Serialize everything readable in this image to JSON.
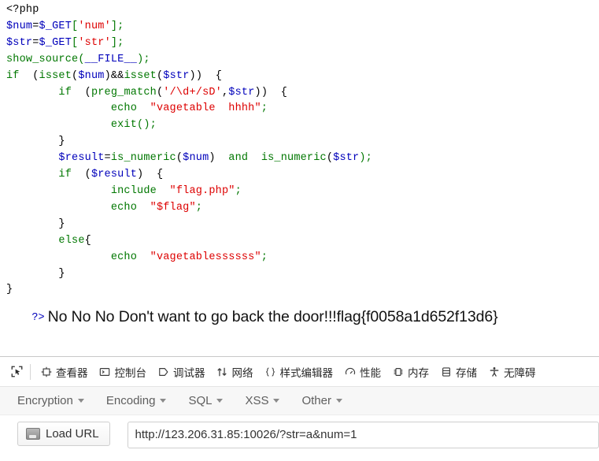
{
  "page": {
    "php_source_lines": [
      [
        {
          "t": "html",
          "s": "<?php"
        }
      ],
      [
        {
          "t": "var",
          "s": "$num"
        },
        {
          "t": "default",
          "s": "="
        },
        {
          "t": "var",
          "s": "$_GET"
        },
        {
          "t": "keyword",
          "s": "["
        },
        {
          "t": "string",
          "s": "'num'"
        },
        {
          "t": "keyword",
          "s": "];"
        }
      ],
      [
        {
          "t": "var",
          "s": "$str"
        },
        {
          "t": "default",
          "s": "="
        },
        {
          "t": "var",
          "s": "$_GET"
        },
        {
          "t": "keyword",
          "s": "["
        },
        {
          "t": "string",
          "s": "'str'"
        },
        {
          "t": "keyword",
          "s": "];"
        }
      ],
      [
        {
          "t": "keyword",
          "s": "show_source"
        },
        {
          "t": "keyword",
          "s": "("
        },
        {
          "t": "var",
          "s": "__FILE__"
        },
        {
          "t": "keyword",
          "s": ");"
        }
      ],
      [
        {
          "t": "keyword",
          "s": "if"
        },
        {
          "t": "default",
          "s": "  ("
        },
        {
          "t": "keyword",
          "s": "isset"
        },
        {
          "t": "default",
          "s": "("
        },
        {
          "t": "var",
          "s": "$num"
        },
        {
          "t": "default",
          "s": ")&&"
        },
        {
          "t": "keyword",
          "s": "isset"
        },
        {
          "t": "default",
          "s": "("
        },
        {
          "t": "var",
          "s": "$str"
        },
        {
          "t": "default",
          "s": "))  {"
        }
      ],
      [
        {
          "t": "default",
          "s": "        "
        },
        {
          "t": "keyword",
          "s": "if"
        },
        {
          "t": "default",
          "s": "  ("
        },
        {
          "t": "keyword",
          "s": "preg_match"
        },
        {
          "t": "default",
          "s": "("
        },
        {
          "t": "string",
          "s": "'/\\d+/sD'"
        },
        {
          "t": "default",
          "s": ","
        },
        {
          "t": "var",
          "s": "$str"
        },
        {
          "t": "default",
          "s": "))  {"
        }
      ],
      [
        {
          "t": "default",
          "s": "                "
        },
        {
          "t": "keyword",
          "s": "echo"
        },
        {
          "t": "default",
          "s": "  "
        },
        {
          "t": "string",
          "s": "\"vagetable  hhhh\""
        },
        {
          "t": "keyword",
          "s": ";"
        }
      ],
      [
        {
          "t": "default",
          "s": "                "
        },
        {
          "t": "keyword",
          "s": "exit"
        },
        {
          "t": "keyword",
          "s": "();"
        }
      ],
      [
        {
          "t": "default",
          "s": "        }"
        }
      ],
      [
        {
          "t": "default",
          "s": "        "
        },
        {
          "t": "var",
          "s": "$result"
        },
        {
          "t": "default",
          "s": "="
        },
        {
          "t": "keyword",
          "s": "is_numeric"
        },
        {
          "t": "default",
          "s": "("
        },
        {
          "t": "var",
          "s": "$num"
        },
        {
          "t": "default",
          "s": ")  "
        },
        {
          "t": "keyword",
          "s": "and"
        },
        {
          "t": "default",
          "s": "  "
        },
        {
          "t": "keyword",
          "s": "is_numeric"
        },
        {
          "t": "default",
          "s": "("
        },
        {
          "t": "var",
          "s": "$str"
        },
        {
          "t": "keyword",
          "s": ");"
        }
      ],
      [
        {
          "t": "default",
          "s": "        "
        },
        {
          "t": "keyword",
          "s": "if"
        },
        {
          "t": "default",
          "s": "  ("
        },
        {
          "t": "var",
          "s": "$result"
        },
        {
          "t": "default",
          "s": ")  {"
        }
      ],
      [
        {
          "t": "default",
          "s": "                "
        },
        {
          "t": "keyword",
          "s": "include"
        },
        {
          "t": "default",
          "s": "  "
        },
        {
          "t": "string",
          "s": "\"flag.php\""
        },
        {
          "t": "keyword",
          "s": ";"
        }
      ],
      [
        {
          "t": "default",
          "s": "                "
        },
        {
          "t": "keyword",
          "s": "echo"
        },
        {
          "t": "default",
          "s": "  "
        },
        {
          "t": "string",
          "s": "\"$flag\""
        },
        {
          "t": "keyword",
          "s": ";"
        }
      ],
      [
        {
          "t": "default",
          "s": "        }"
        }
      ],
      [
        {
          "t": "default",
          "s": "        "
        },
        {
          "t": "keyword",
          "s": "else"
        },
        {
          "t": "default",
          "s": "{"
        }
      ],
      [
        {
          "t": "default",
          "s": "                "
        },
        {
          "t": "keyword",
          "s": "echo"
        },
        {
          "t": "default",
          "s": "  "
        },
        {
          "t": "string",
          "s": "\"vagetablessssss\""
        },
        {
          "t": "keyword",
          "s": ";"
        }
      ],
      [
        {
          "t": "default",
          "s": "        }"
        }
      ],
      [
        {
          "t": "default",
          "s": "}"
        }
      ]
    ],
    "close_tag": "?>",
    "echo_output": "No No No Don't want to go back the door!!!flag{f0058a1d652f13d6}"
  },
  "devtools": {
    "picker_icon": "element-picker-icon",
    "tabs": [
      {
        "label": "查看器",
        "icon": "inspector-icon",
        "selected": false
      },
      {
        "label": "控制台",
        "icon": "console-icon",
        "selected": false
      },
      {
        "label": "调试器",
        "icon": "debugger-icon",
        "selected": false
      },
      {
        "label": "网络",
        "icon": "network-icon",
        "selected": false
      },
      {
        "label": "样式编辑器",
        "icon": "style-editor-icon",
        "selected": false
      },
      {
        "label": "性能",
        "icon": "performance-icon",
        "selected": false
      },
      {
        "label": "内存",
        "icon": "memory-icon",
        "selected": false
      },
      {
        "label": "存储",
        "icon": "storage-icon",
        "selected": false
      },
      {
        "label": "无障碍",
        "icon": "accessibility-icon",
        "selected": false
      }
    ]
  },
  "hackbar": {
    "menus": [
      {
        "label": "Encryption"
      },
      {
        "label": "Encoding"
      },
      {
        "label": "SQL"
      },
      {
        "label": "XSS"
      },
      {
        "label": "Other"
      }
    ],
    "load_url_label": "Load URL",
    "url_value": "http://123.206.31.85:10026/?str=a&num=1",
    "url_placeholder": ""
  },
  "colors": {
    "php_default": "#000000",
    "php_keyword": "#007700",
    "php_string": "#DD0000",
    "php_var": "#0000BB",
    "hackbar_bar_bg": "#f7f7f7",
    "devtools_text": "#2b2b2b"
  }
}
